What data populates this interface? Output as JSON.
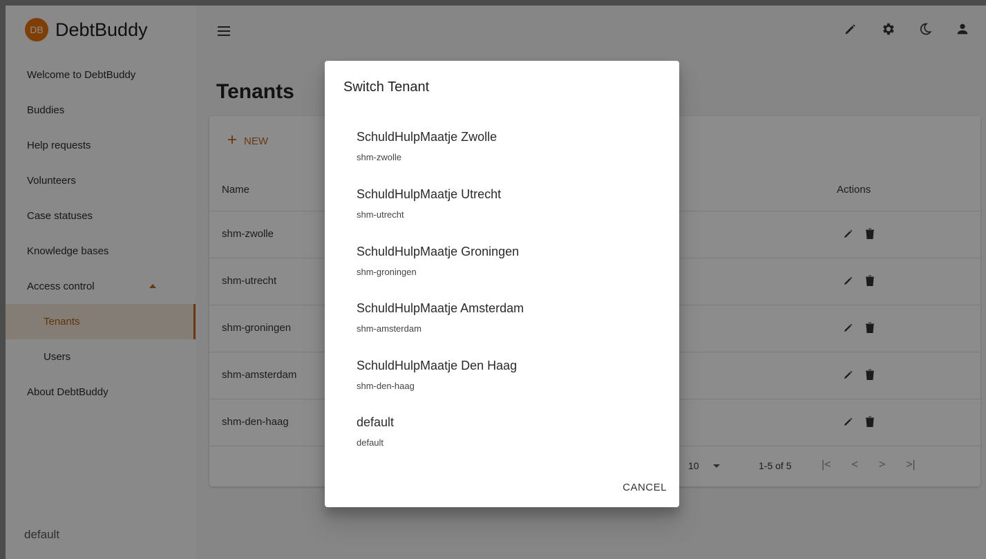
{
  "app": {
    "logo_initials": "DB",
    "name": "DebtBuddy",
    "accent_color": "#c0671a"
  },
  "sidebar": {
    "items": [
      {
        "label": "Welcome to DebtBuddy"
      },
      {
        "label": "Buddies"
      },
      {
        "label": "Help requests"
      },
      {
        "label": "Volunteers"
      },
      {
        "label": "Case statuses"
      },
      {
        "label": "Knowledge bases"
      },
      {
        "label": "Access control",
        "expanded": true
      },
      {
        "label": "Tenants",
        "active": true
      },
      {
        "label": "Users"
      },
      {
        "label": "About DebtBuddy"
      }
    ],
    "footer_tenant": "default"
  },
  "topbar": {
    "icons": [
      "menu-icon",
      "pencil-icon",
      "gear-icon",
      "moon-icon",
      "user-icon"
    ]
  },
  "page": {
    "title": "Tenants",
    "new_button": "NEW",
    "columns": {
      "name": "Name",
      "actions": "Actions"
    },
    "rows": [
      "shm-zwolle",
      "shm-utrecht",
      "shm-groningen",
      "shm-amsterdam",
      "shm-den-haag"
    ],
    "pagination": {
      "page_size": "10",
      "range": "1-5 of 5"
    }
  },
  "dialog": {
    "title": "Switch Tenant",
    "tenants": [
      {
        "name": "SchuldHulpMaatje Zwolle",
        "id": "shm-zwolle"
      },
      {
        "name": "SchuldHulpMaatje Utrecht",
        "id": "shm-utrecht"
      },
      {
        "name": "SchuldHulpMaatje Groningen",
        "id": "shm-groningen"
      },
      {
        "name": "SchuldHulpMaatje Amsterdam",
        "id": "shm-amsterdam"
      },
      {
        "name": "SchuldHulpMaatje Den Haag",
        "id": "shm-den-haag"
      },
      {
        "name": "default",
        "id": "default"
      }
    ],
    "cancel_label": "CANCEL"
  }
}
